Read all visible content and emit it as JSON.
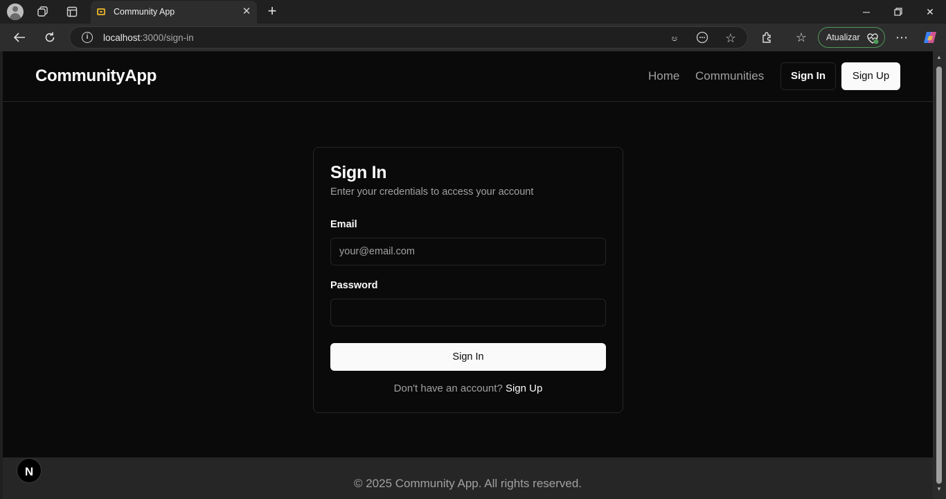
{
  "browser": {
    "tab": {
      "title": "Community App"
    },
    "address": {
      "host": "localhost",
      "rest": ":3000/sign-in"
    },
    "update_button": "Atualizar"
  },
  "header": {
    "logo": "CommunityApp",
    "nav": {
      "home": "Home",
      "communities": "Communities"
    },
    "sign_in": "Sign In",
    "sign_up": "Sign Up"
  },
  "card": {
    "title": "Sign In",
    "description": "Enter your credentials to access your account",
    "email_label": "Email",
    "email_placeholder": "your@email.com",
    "password_label": "Password",
    "password_value": "",
    "submit": "Sign In",
    "footer_prompt": "Don't have an account?",
    "footer_link": "Sign Up"
  },
  "footer": {
    "text": "© 2025 Community App. All rights reserved."
  },
  "dev_badge": {
    "letter": "N"
  },
  "colors": {
    "page_bg": "#0a0a0a",
    "foreground": "#fafafa",
    "muted": "#a1a1a1",
    "border": "#262626",
    "update_accent": "#4f9a58"
  }
}
